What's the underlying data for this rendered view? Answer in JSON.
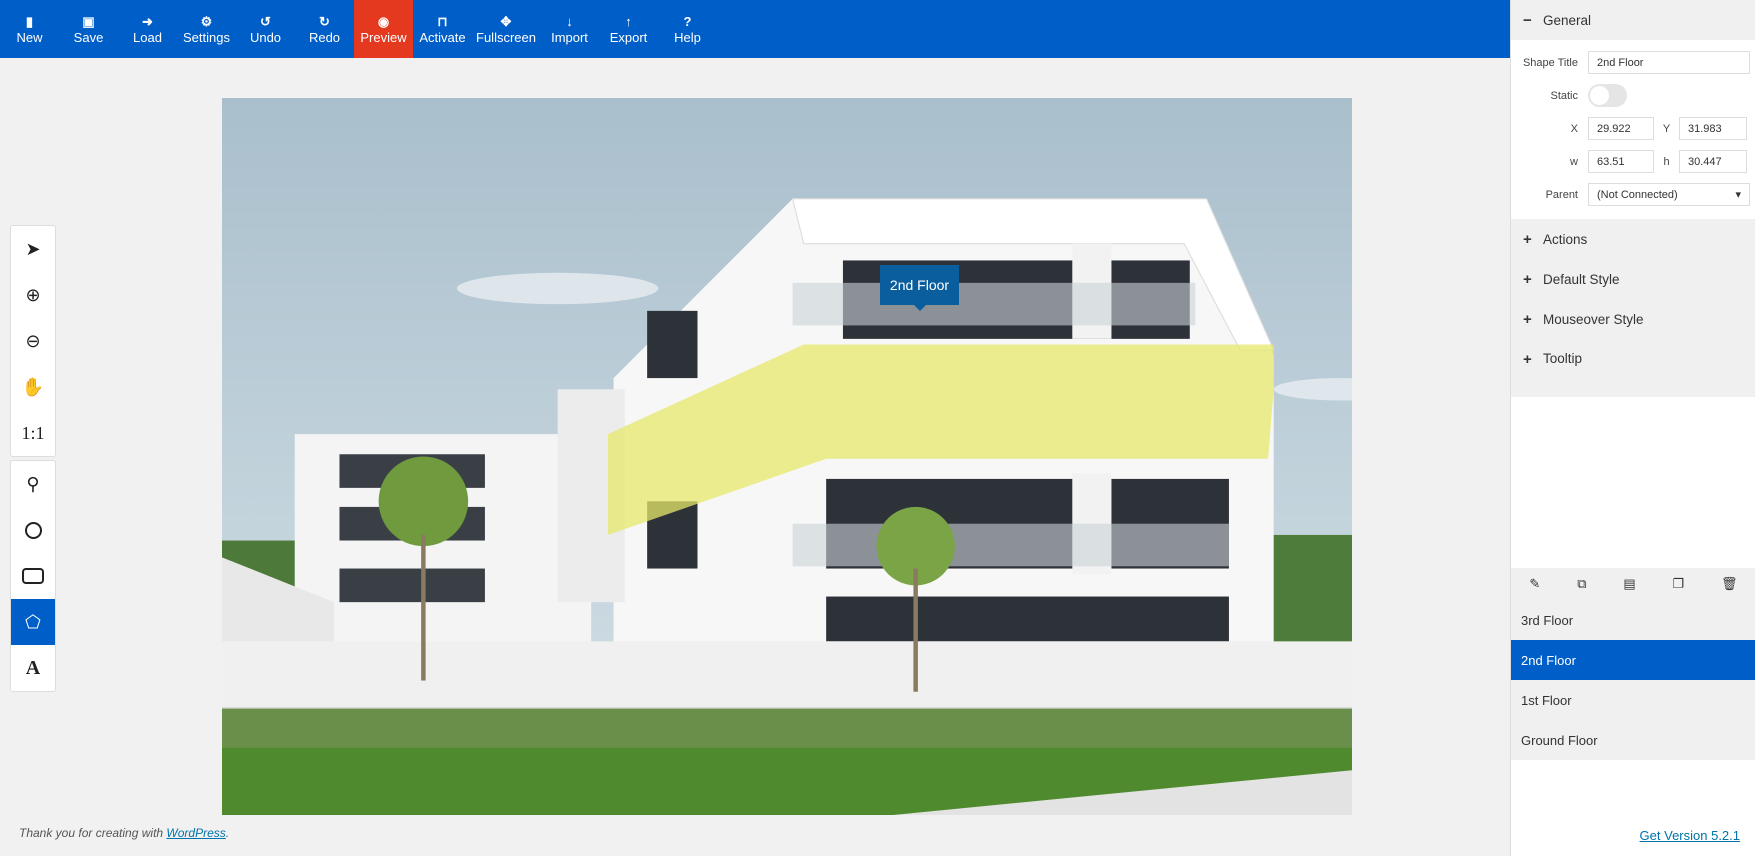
{
  "toolbar": {
    "items": [
      {
        "label": "New",
        "icon": "file-icon",
        "glyph": "▮"
      },
      {
        "label": "Save",
        "icon": "floppy-icon",
        "glyph": "🖫"
      },
      {
        "label": "Load",
        "icon": "sign-in-icon",
        "glyph": "➜"
      },
      {
        "label": "Settings",
        "icon": "gear-icon",
        "glyph": "⚙"
      },
      {
        "label": "Undo",
        "icon": "undo-icon",
        "glyph": "↺"
      },
      {
        "label": "Redo",
        "icon": "redo-icon",
        "glyph": "↻"
      },
      {
        "label": "Preview",
        "icon": "eye-icon",
        "glyph": "◉"
      },
      {
        "label": "Activate",
        "icon": "unlock-icon",
        "glyph": "🔓"
      },
      {
        "label": "Fullscreen",
        "icon": "expand-icon",
        "glyph": "✥"
      },
      {
        "label": "Import",
        "icon": "arrow-down-icon",
        "glyph": "↓"
      },
      {
        "label": "Export",
        "icon": "arrow-up-icon",
        "glyph": "↑"
      },
      {
        "label": "Help",
        "icon": "question-icon",
        "glyph": "?"
      }
    ],
    "active": "Preview",
    "accent": "#005ec9",
    "active_color": "#e4381f"
  },
  "tools": {
    "zoom_reset": "1:1",
    "text_tool": "A",
    "active": "polygon"
  },
  "canvas": {
    "tooltip": "2nd Floor",
    "highlight_color": "#e6e86a"
  },
  "footer": {
    "prefix": "Thank you for creating with ",
    "link": "WordPress",
    "suffix": "."
  },
  "sidebar": {
    "general": {
      "title": "General",
      "shape_title_label": "Shape Title",
      "shape_title": "2nd Floor",
      "static_label": "Static",
      "static": false,
      "x_label": "X",
      "x": "29.922",
      "y_label": "Y",
      "y": "31.983",
      "w_label": "w",
      "w": "63.51",
      "h_label": "h",
      "h": "30.447",
      "parent_label": "Parent",
      "parent": "(Not Connected)"
    },
    "sections": [
      "Actions",
      "Default Style",
      "Mouseover Style",
      "Tooltip"
    ],
    "shapes": [
      "3rd Floor",
      "2nd Floor",
      "1st Floor",
      "Ground Floor"
    ],
    "selected_shape": "2nd Floor",
    "version_link": "Get Version 5.2.1"
  }
}
